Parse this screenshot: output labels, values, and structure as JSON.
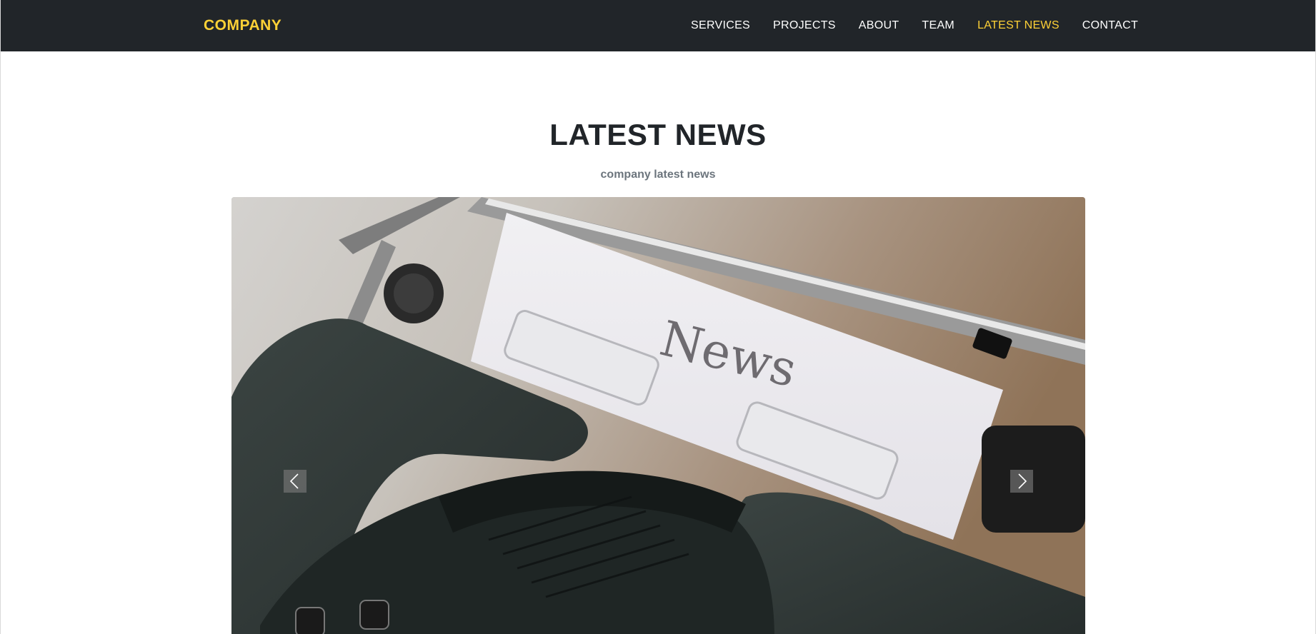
{
  "navbar": {
    "brand": "COMPANY",
    "items": [
      {
        "label": "SERVICES"
      },
      {
        "label": "PROJECTS"
      },
      {
        "label": "ABOUT"
      },
      {
        "label": "TEAM"
      },
      {
        "label": "LATEST NEWS",
        "active": true
      },
      {
        "label": "CONTACT"
      }
    ]
  },
  "section": {
    "title": "LATEST NEWS",
    "subtitle": "company latest news"
  },
  "carousel": {
    "slide_text": "News",
    "prev_icon": "chevron-left-icon",
    "next_icon": "chevron-right-icon"
  },
  "colors": {
    "navbar_bg": "#212529",
    "accent": "#fed136",
    "heading": "#212529",
    "subtitle": "#6c757d"
  }
}
